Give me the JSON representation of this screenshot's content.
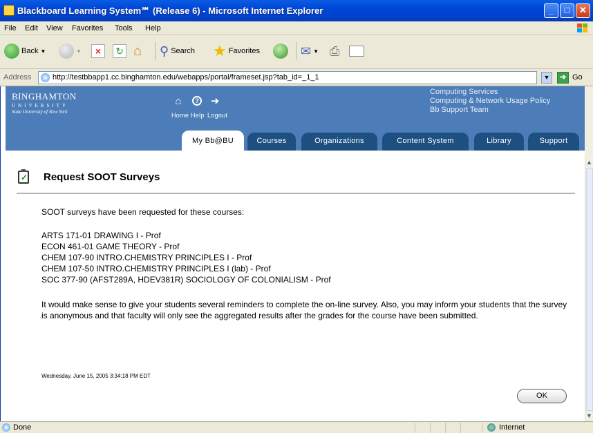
{
  "window": {
    "title": "Blackboard Learning System℠ (Release 6) - Microsoft Internet Explorer",
    "minimize": "_",
    "maximize": "□",
    "close": "✕"
  },
  "menu": [
    "File",
    "Edit",
    "View",
    "Favorites",
    "Tools",
    "Help"
  ],
  "toolbar": {
    "back_label": "Back",
    "search_label": "Search",
    "favorites_label": "Favorites"
  },
  "address": {
    "label": "Address",
    "url": "http://testbbapp1.cc.binghamton.edu/webapps/portal/frameset.jsp?tab_id=_1_1",
    "go_label": "Go"
  },
  "header": {
    "logo_line1": "BINGHAMTON",
    "logo_line2": "UNIVERSITY",
    "logo_line3": "State University of New York",
    "home_label": "Home",
    "help_label": "Help",
    "logout_label": "Logout",
    "side_links": [
      "Computing Services",
      "Computing & Network Usage Policy",
      "Bb Support Team"
    ]
  },
  "tabs": [
    "My Bb@BU",
    "Courses",
    "Organizations",
    "Content System",
    "Library",
    "Support"
  ],
  "content": {
    "title": "Request SOOT Surveys",
    "intro": "SOOT surveys have been requested for these courses:",
    "courses": [
      "ARTS 171-01 DRAWING I - Prof",
      "ECON 461-01 GAME THEORY - Prof",
      "CHEM 107-90 INTRO.CHEMISTRY PRINCIPLES I - Prof",
      "CHEM 107-50 INTRO.CHEMISTRY PRINCIPLES I (lab) - Prof",
      "SOC 377-90 (AFST289A, HDEV381R) SOCIOLOGY OF COLONIALISM - Prof"
    ],
    "paragraph": "It would make sense to give your students several reminders to complete the on-line survey. Also, you may inform your students that the survey is anonymous and that faculty will only see the aggregated results after the grades for the course have been submitted.",
    "timestamp": "Wednesday, June 15, 2005 3:34:18 PM EDT",
    "ok_label": "OK"
  },
  "status": {
    "text": "Done",
    "zone": "Internet"
  },
  "colors": {
    "header_blue": "#4c7db8",
    "tab_dark": "#1d4f80",
    "xp_title": "#0046d6"
  }
}
